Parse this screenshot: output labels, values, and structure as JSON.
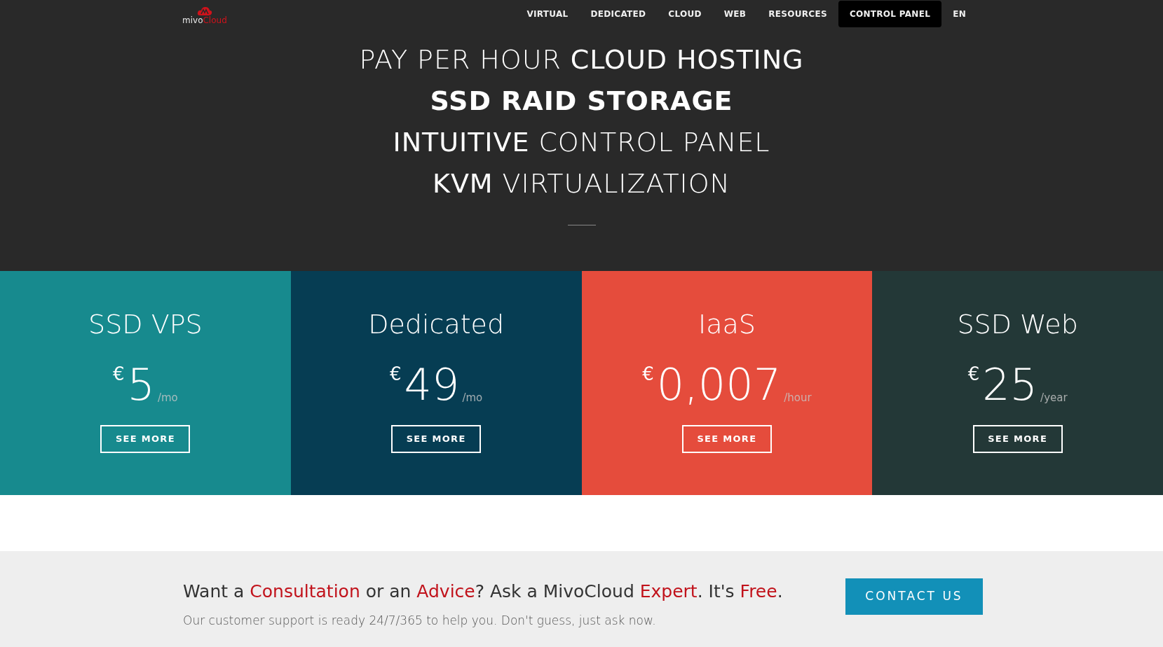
{
  "logo": {
    "part_1": "mivo",
    "part_2": "Cloud"
  },
  "nav": [
    {
      "label": "VIRTUAL",
      "selected": false
    },
    {
      "label": "DEDICATED",
      "selected": false
    },
    {
      "label": "CLOUD",
      "selected": false
    },
    {
      "label": "WEB",
      "selected": false
    },
    {
      "label": "RESOURCES",
      "selected": false
    },
    {
      "label": "CONTROL PANEL",
      "selected": true
    },
    {
      "label": "EN",
      "selected": false
    }
  ],
  "hero": {
    "lines": [
      {
        "text": "PAY PER HOUR **CLOUD HOSTING**",
        "bold": false
      },
      {
        "text": "SSD RAID STORAGE",
        "bold": true
      },
      {
        "text": "**INTUITIVE** CONTROL PANEL",
        "bold": false
      },
      {
        "text": "**KVM** VIRTUALIZATION",
        "bold": false
      }
    ]
  },
  "plans": [
    {
      "title": "SSD VPS",
      "currency": "€",
      "price": "5",
      "period": "/mo",
      "button": "SEE MORE",
      "color": "#178a8e"
    },
    {
      "title": "Dedicated",
      "currency": "€",
      "price": "49",
      "period": "/mo",
      "button": "SEE MORE",
      "color": "#063d53"
    },
    {
      "title": "IaaS",
      "currency": "€",
      "price": "0,007",
      "period": "/hour",
      "button": "SEE MORE",
      "color": "#e54c3c"
    },
    {
      "title": "SSD Web",
      "currency": "€",
      "price": "25",
      "period": "/year",
      "button": "SEE MORE",
      "color": "#233837"
    }
  ],
  "consultation": {
    "headline": [
      {
        "text": "Want a ",
        "highlight": false
      },
      {
        "text": "Consultation",
        "highlight": true
      },
      {
        "text": " or an ",
        "highlight": false
      },
      {
        "text": "Advice",
        "highlight": true
      },
      {
        "text": "? Ask a MivoCloud ",
        "highlight": false
      },
      {
        "text": "Expert",
        "highlight": true
      },
      {
        "text": ". It's ",
        "highlight": false
      },
      {
        "text": "Free",
        "highlight": true
      },
      {
        "text": ".",
        "highlight": false
      }
    ],
    "subtext": "Our customer support is ready 24/7/365 to help you. Don't guess, just ask now.",
    "button": "CONTACT US"
  }
}
